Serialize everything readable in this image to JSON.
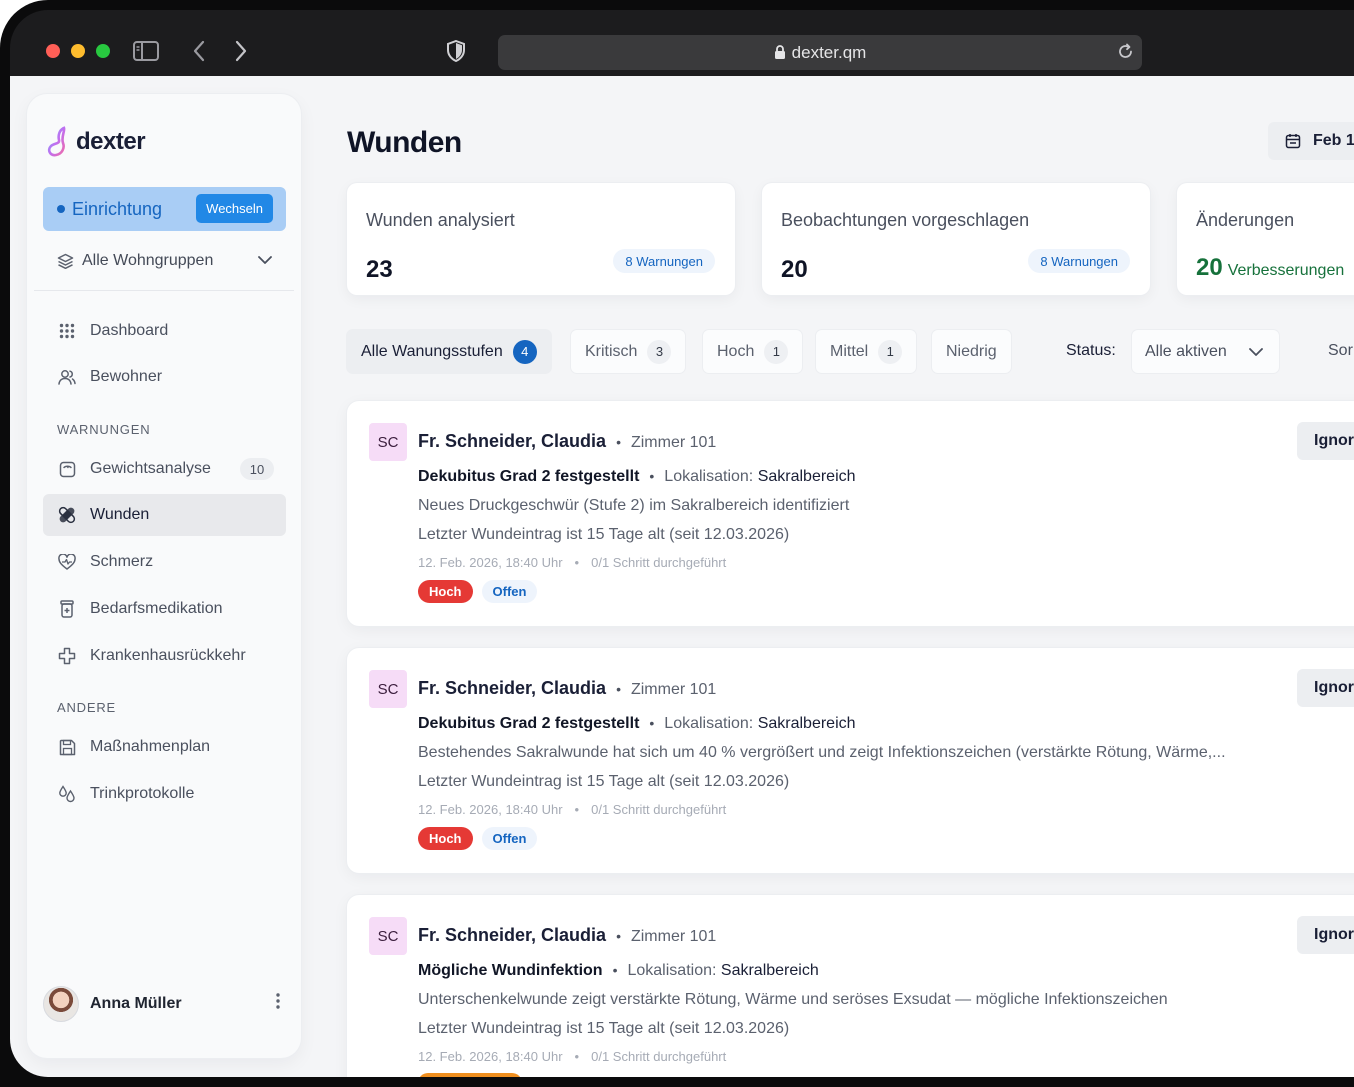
{
  "browser": {
    "url": "dexter.qm"
  },
  "brand": {
    "name": "dexter"
  },
  "facility": {
    "label": "Einrichtung",
    "switch_label": "Wechseln"
  },
  "group_select": {
    "value": "Alle Wohngruppen"
  },
  "nav": {
    "main": [
      {
        "label": "Dashboard",
        "icon": "grid-icon"
      },
      {
        "label": "Bewohner",
        "icon": "users-icon"
      }
    ],
    "warnings_heading": "WARNUNGEN",
    "warnings": [
      {
        "label": "Gewichtsanalyse",
        "icon": "scale-icon",
        "count": "10"
      },
      {
        "label": "Wunden",
        "icon": "bandage-icon",
        "active": true
      },
      {
        "label": "Schmerz",
        "icon": "heart-pulse-icon"
      },
      {
        "label": "Bedarfsmedikation",
        "icon": "medicine-icon"
      },
      {
        "label": "Krankenhausrückkehr",
        "icon": "medical-cross-icon"
      }
    ],
    "other_heading": "ANDERE",
    "other": [
      {
        "label": "Maßnahmenplan",
        "icon": "save-icon"
      },
      {
        "label": "Trinkprotokolle",
        "icon": "drops-icon"
      }
    ]
  },
  "user": {
    "name": "Anna Müller"
  },
  "page": {
    "title": "Wunden",
    "date_label": "Feb 1"
  },
  "stats": [
    {
      "title": "Wunden analysiert",
      "value": "23",
      "badge": "8 Warnungen"
    },
    {
      "title": "Beobachtungen vorgeschlagen",
      "value": "20",
      "badge": "8 Warnungen"
    },
    {
      "title": "Änderungen",
      "value": "20",
      "value_suffix": "Verbesserungen"
    }
  ],
  "filters": {
    "chips": [
      {
        "label": "Alle Wanungsstufen",
        "count": "4",
        "active": true
      },
      {
        "label": "Kritisch",
        "count": "3"
      },
      {
        "label": "Hoch",
        "count": "1"
      },
      {
        "label": "Mittel",
        "count": "1"
      },
      {
        "label": "Niedrig"
      }
    ],
    "status_label": "Status:",
    "status_value": "Alle aktiven",
    "sort_label": "Sor"
  },
  "cards": [
    {
      "initials": "SC",
      "name": "Fr. Schneider, Claudia",
      "room": "Zimmer 101",
      "diagnosis": "Dekubitus Grad 2 festgestellt",
      "location_label": "Lokalisation:",
      "location_value": "Sakralbereich",
      "description": "Neues Druckgeschwür (Stufe 2) im Sakralbereich identifiziert",
      "last_entry": "Letzter Wundeintrag ist 15 Tage alt (seit 12.03.2026)",
      "timestamp": "12. Feb. 2026, 18:40 Uhr",
      "progress": "0/1 Schritt durchgeführt",
      "severity": "Hoch",
      "status": "Offen",
      "action": "Ignor"
    },
    {
      "initials": "SC",
      "name": "Fr. Schneider, Claudia",
      "room": "Zimmer 101",
      "diagnosis": "Dekubitus Grad 2 festgestellt",
      "location_label": "Lokalisation:",
      "location_value": "Sakralbereich",
      "description": "Bestehendes Sakralwunde hat sich um 40 % vergrößert und zeigt Infektionszeichen (verstärkte Rötung, Wärme,...",
      "last_entry": "Letzter Wundeintrag ist 15 Tage alt (seit 12.03.2026)",
      "timestamp": "12. Feb. 2026, 18:40 Uhr",
      "progress": "0/1 Schritt durchgeführt",
      "severity": "Hoch",
      "status": "Offen",
      "action": "Ignor"
    },
    {
      "initials": "SC",
      "name": "Fr. Schneider, Claudia",
      "room": "Zimmer 101",
      "diagnosis": "Mögliche Wundinfektion",
      "location_label": "Lokalisation:",
      "location_value": "Sakralbereich",
      "description": "Unterschenkelwunde zeigt verstärkte Rötung, Wärme und seröses Exsudat — mögliche Infektionszeichen",
      "last_entry": "Letzter Wundeintrag ist 15 Tage alt (seit 12.03.2026)",
      "timestamp": "12. Feb. 2026, 18:40 Uhr",
      "progress": "0/1 Schritt durchgeführt",
      "action": "Ignor"
    }
  ],
  "separators": {
    "dot": "•"
  },
  "colors": {
    "accent": "#1565c0",
    "facility_bg": "#a9cdf5",
    "danger": "#e53935",
    "success": "#16713b",
    "warning": "#ef8f1f"
  }
}
